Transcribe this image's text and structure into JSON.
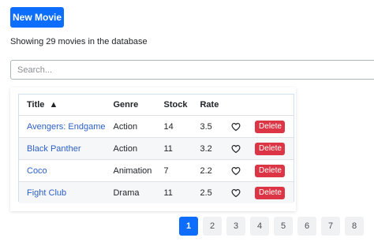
{
  "toolbar": {
    "new_movie_label": "New Movie"
  },
  "summary_text": "Showing 29 movies in the database",
  "search": {
    "placeholder": "Search...",
    "value": ""
  },
  "table": {
    "headers": {
      "title": "Title",
      "sort_indicator": "▲",
      "genre": "Genre",
      "stock": "Stock",
      "rate": "Rate"
    },
    "rows": [
      {
        "title": "Avengers: Endgame",
        "genre": "Action",
        "stock": "14",
        "rate": "3.5",
        "liked": false,
        "delete_label": "Delete"
      },
      {
        "title": "Black Panther",
        "genre": "Action",
        "stock": "11",
        "rate": "3.2",
        "liked": false,
        "delete_label": "Delete"
      },
      {
        "title": "Coco",
        "genre": "Animation",
        "stock": "7",
        "rate": "2.2",
        "liked": false,
        "delete_label": "Delete"
      },
      {
        "title": "Fight Club",
        "genre": "Drama",
        "stock": "11",
        "rate": "2.5",
        "liked": false,
        "delete_label": "Delete"
      }
    ]
  },
  "pagination": {
    "current": "1",
    "pages": [
      "1",
      "2",
      "3",
      "4",
      "5",
      "6",
      "7",
      "8"
    ]
  },
  "colors": {
    "primary": "#0d6efd",
    "danger": "#dc3545",
    "link": "#2b5fc9"
  },
  "icons": {
    "like": "heart-outline-icon"
  }
}
